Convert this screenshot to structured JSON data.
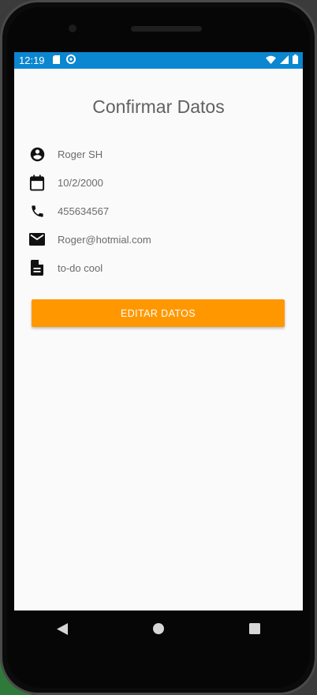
{
  "statusbar": {
    "time": "12:19",
    "color": "#0b86d1"
  },
  "screen": {
    "title": "Confirmar Datos"
  },
  "fields": [
    {
      "icon": "account-circle-icon",
      "value": "Roger SH"
    },
    {
      "icon": "calendar-icon",
      "value": "10/2/2000"
    },
    {
      "icon": "phone-icon",
      "value": "455634567"
    },
    {
      "icon": "email-icon",
      "value": "Roger@hotmial.com"
    },
    {
      "icon": "document-icon",
      "value": "to-do cool"
    }
  ],
  "button": {
    "label": "EDITAR DATOS",
    "color": "#ff9800"
  },
  "navbar": {
    "icons": [
      "back-icon",
      "home-icon",
      "recents-icon"
    ]
  }
}
